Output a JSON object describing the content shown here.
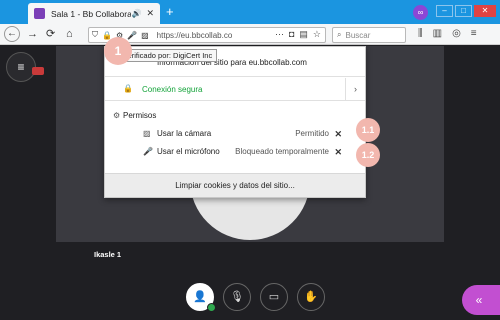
{
  "browser": {
    "tab_title": "Sala 1 - Bb Collaborate",
    "tab_audio_icon": "speaker-icon",
    "new_tab_label": "+",
    "url": "https://eu.bbcollab.co",
    "search_placeholder": "Buscar"
  },
  "site_info": {
    "title": "Información del sitio para eu.bbcollab.com",
    "tooltip": "Verificado por: DigiCert Inc",
    "connection": "Conexión segura",
    "permissions_heading": "Permisos",
    "permissions": [
      {
        "label": "Usar la cámara",
        "status": "Permitido",
        "icon": "camera-off-icon"
      },
      {
        "label": "Usar el micrófono",
        "status": "Bloqueado temporalmente",
        "icon": "microphone-icon"
      }
    ],
    "clear_label": "Limpiar cookies y datos del sitio..."
  },
  "steps": {
    "one": "1",
    "one_one": "1.1",
    "one_two": "1.2"
  },
  "session": {
    "participant_name": "Ikasle 1"
  },
  "colors": {
    "titlebar": "#1b95e0",
    "secure_green": "#14a33a",
    "step_badge": "#f2b7ae",
    "collab_panel": "#c24fd1"
  }
}
